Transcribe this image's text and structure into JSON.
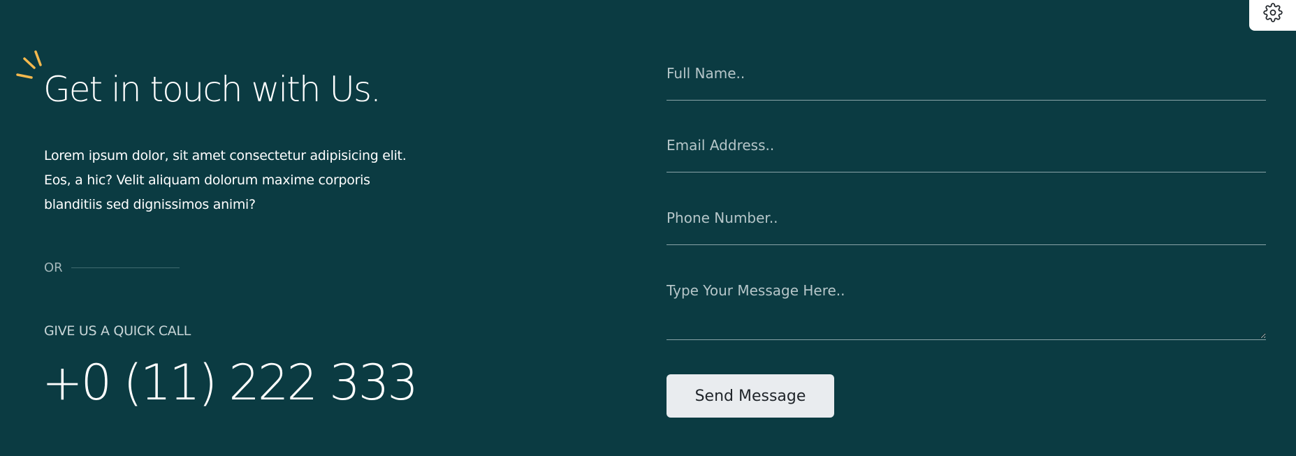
{
  "colors": {
    "background": "#0b3b42",
    "accent": "#f5b94e",
    "text": "#ffffff",
    "muted": "#a3b7ba",
    "button_bg": "#e9ecef",
    "button_text": "#1f2429"
  },
  "settings": {
    "icon": "gear-icon"
  },
  "contact": {
    "heading": "Get in touch with Us.",
    "description_lines": [
      "Lorem ipsum dolor, sit amet consectetur adipisicing elit.",
      "Eos, a hic? Velit aliquam dolorum maxime corporis",
      "blanditiis sed dignissimos animi?"
    ],
    "or_label": "OR",
    "call_label": "GIVE US A QUICK CALL",
    "phone": "+0 (11) 222 333"
  },
  "form": {
    "full_name": {
      "placeholder": "Full Name..",
      "value": ""
    },
    "email": {
      "placeholder": "Email Address..",
      "value": ""
    },
    "phone": {
      "placeholder": "Phone Number..",
      "value": ""
    },
    "message": {
      "placeholder": "Type Your Message Here..",
      "value": ""
    },
    "submit_label": "Send Message"
  }
}
